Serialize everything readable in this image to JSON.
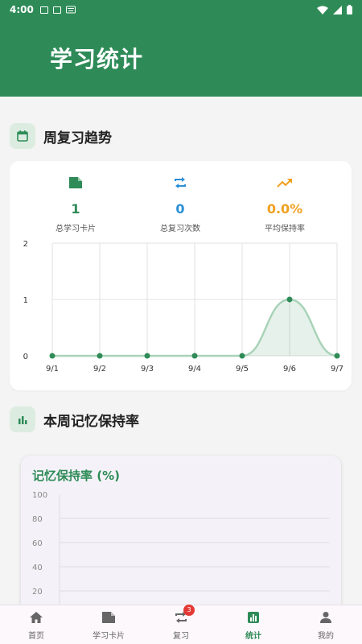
{
  "status_bar": {
    "time": "4:00"
  },
  "header": {
    "title": "学习统计"
  },
  "weekly_section": {
    "title": "周复习趋势"
  },
  "stats": [
    {
      "value": "1",
      "label": "总学习卡片",
      "color": "#2e8b57",
      "icon": "card-icon"
    },
    {
      "value": "0",
      "label": "总复习次数",
      "color": "#2a8fd6",
      "icon": "repeat-icon"
    },
    {
      "value": "0.0%",
      "label": "平均保持率",
      "color": "#f0a020",
      "icon": "trending-up-icon"
    }
  ],
  "retention_section": {
    "title": "本周记忆保持率"
  },
  "retention_chart_title": "记忆保持率 (%)",
  "chart_data": [
    {
      "type": "area",
      "categories": [
        "9/1",
        "9/2",
        "9/3",
        "9/4",
        "9/5",
        "9/6",
        "9/7"
      ],
      "values": [
        0,
        0,
        0,
        0,
        0,
        1,
        0
      ],
      "ylim": [
        0,
        2
      ],
      "yticks": [
        "0",
        "1",
        "2"
      ],
      "grid": true,
      "color": "#2e8b57"
    },
    {
      "type": "line",
      "title": "记忆保持率 (%)",
      "ylim": [
        0,
        100
      ],
      "yticks": [
        "100",
        "80",
        "60",
        "40",
        "20"
      ],
      "grid": true
    }
  ],
  "bottom_nav": [
    {
      "label": "首页",
      "icon": "home-icon",
      "active": false
    },
    {
      "label": "学习卡片",
      "icon": "card-icon",
      "active": false
    },
    {
      "label": "复习",
      "icon": "repeat-icon",
      "active": false,
      "badge": "3"
    },
    {
      "label": "统计",
      "icon": "chart-icon",
      "active": true
    },
    {
      "label": "我的",
      "icon": "person-icon",
      "active": false
    }
  ]
}
